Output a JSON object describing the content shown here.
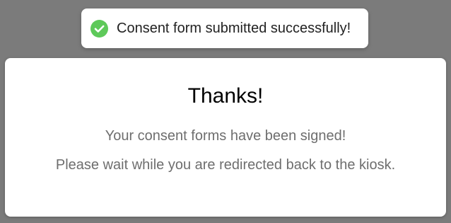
{
  "toast": {
    "icon": "check-circle-icon",
    "message": "Consent form submitted successfully!",
    "accent_color": "#5ec95a"
  },
  "modal": {
    "title": "Thanks!",
    "line1": "Your consent forms have been signed!",
    "line2": "Please wait while you are redirected back to the kiosk."
  },
  "colors": {
    "backdrop": "#7b7b7b",
    "modal_background": "#ffffff",
    "body_text": "#6e6e6e"
  }
}
